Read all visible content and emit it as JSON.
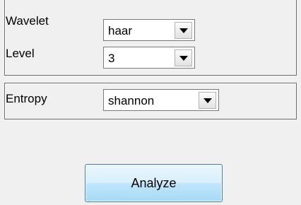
{
  "signal_params": {
    "wavelet": {
      "label": "Wavelet",
      "value": "haar"
    },
    "level": {
      "label": "Level",
      "value": "3"
    }
  },
  "entropy": {
    "label": "Entropy",
    "value": "shannon"
  },
  "analyze_button": {
    "label": "Analyze"
  }
}
